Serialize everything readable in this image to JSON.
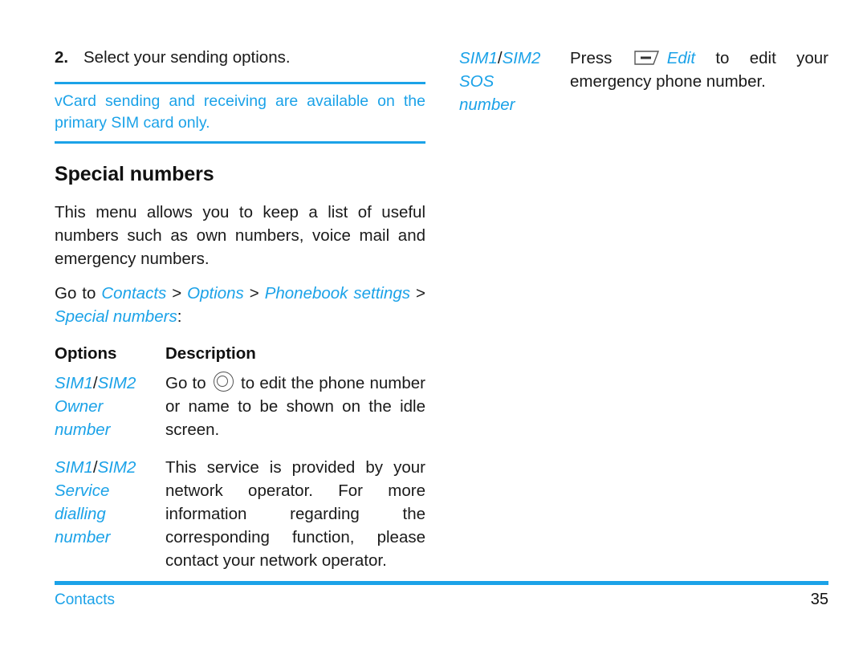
{
  "page": {
    "footer_section": "Contacts",
    "page_number": "35",
    "accent_color": "#1ba2e8",
    "text_color": "#1a1a1a"
  },
  "left_column": {
    "step": {
      "number": "2.",
      "text": "Select your sending options."
    },
    "note": {
      "text": "vCard sending and receiving are available on the primary SIM card only."
    },
    "section_title": "Special numbers",
    "intro_paragraph": "This menu allows you to keep a list of useful numbers such as own numbers, voice mail and emergency numbers.",
    "path": {
      "prefix": "Go to ",
      "items": [
        "Contacts",
        "Options",
        "Phonebook settings",
        "Special numbers"
      ],
      "separator": " > ",
      "suffix": ":"
    },
    "table": {
      "headers": {
        "options": "Options",
        "description": "Description"
      },
      "rows": [
        {
          "option_lines": [
            "SIM1/SIM2",
            "Owner",
            "number"
          ],
          "option_sim1": "SIM1",
          "option_slash": "/",
          "option_sim2": "SIM2",
          "description_before_icon": "Go to ",
          "icon": "navigation-ok-key-icon",
          "description_after_icon": " to edit the phone number or name to be shown on the idle screen."
        },
        {
          "option_lines": [
            "SIM1/SIM2",
            "Service",
            "dialling",
            "number"
          ],
          "option_sim1": "SIM1",
          "option_slash": "/",
          "option_sim2": "SIM2",
          "description": "This service is provided by your network operator. For more information regarding the corresponding function, please contact your network operator."
        }
      ]
    }
  },
  "right_column": {
    "table": {
      "rows": [
        {
          "option_lines": [
            "SIM1/SIM2",
            "SOS",
            "number"
          ],
          "option_sim1": "SIM1",
          "option_slash": "/",
          "option_sim2": "SIM2",
          "description_before_icon": "Press ",
          "icon": "left-soft-key-icon",
          "icon_label": "Edit",
          "description_after_icon": " to edit your emergency phone number."
        }
      ]
    }
  }
}
